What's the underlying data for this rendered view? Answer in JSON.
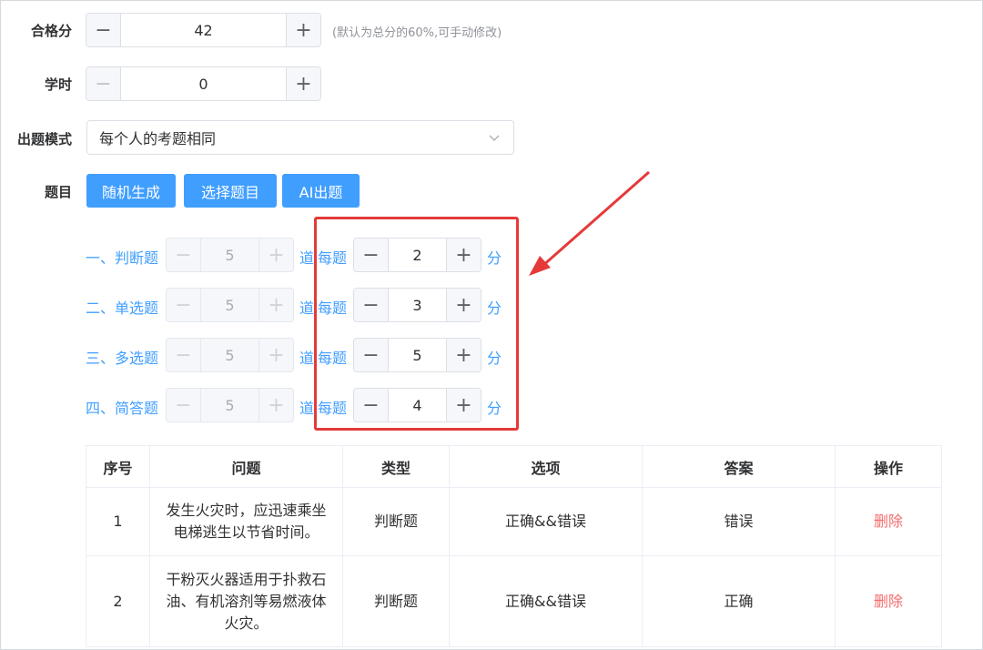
{
  "form": {
    "pass_score": {
      "label": "合格分",
      "value": "42",
      "hint": "(默认为总分的60%,可手动修改)"
    },
    "hours": {
      "label": "学时",
      "value": "0"
    },
    "mode": {
      "label": "出题模式",
      "selected": "每个人的考题相同"
    },
    "questions": {
      "label": "题目",
      "buttons": [
        "随机生成",
        "选择题目",
        "AI出题"
      ]
    }
  },
  "stepper_icons": {
    "minus": "−",
    "plus": "+"
  },
  "question_types": [
    {
      "label": "一、判断题",
      "count": "5",
      "unit": "道",
      "per_label": "每题",
      "score": "2",
      "score_unit": "分"
    },
    {
      "label": "二、单选题",
      "count": "5",
      "unit": "道",
      "per_label": "每题",
      "score": "3",
      "score_unit": "分"
    },
    {
      "label": "三、多选题",
      "count": "5",
      "unit": "道",
      "per_label": "每题",
      "score": "5",
      "score_unit": "分"
    },
    {
      "label": "四、简答题",
      "count": "5",
      "unit": "道",
      "per_label": "每题",
      "score": "4",
      "score_unit": "分"
    }
  ],
  "table": {
    "headers": [
      "序号",
      "问题",
      "类型",
      "选项",
      "答案",
      "操作"
    ],
    "rows": [
      {
        "no": "1",
        "question": "发生火灾时，应迅速乘坐电梯逃生以节省时间。",
        "type": "判断题",
        "options": "正确&&错误",
        "answer": "错误",
        "action": "删除"
      },
      {
        "no": "2",
        "question": "干粉灭火器适用于扑救石油、有机溶剂等易燃液体火灾。",
        "type": "判断题",
        "options": "正确&&错误",
        "answer": "正确",
        "action": "删除"
      }
    ]
  },
  "colors": {
    "primary": "#409eff",
    "danger": "#f56c6c",
    "highlight": "#e43a3a"
  }
}
